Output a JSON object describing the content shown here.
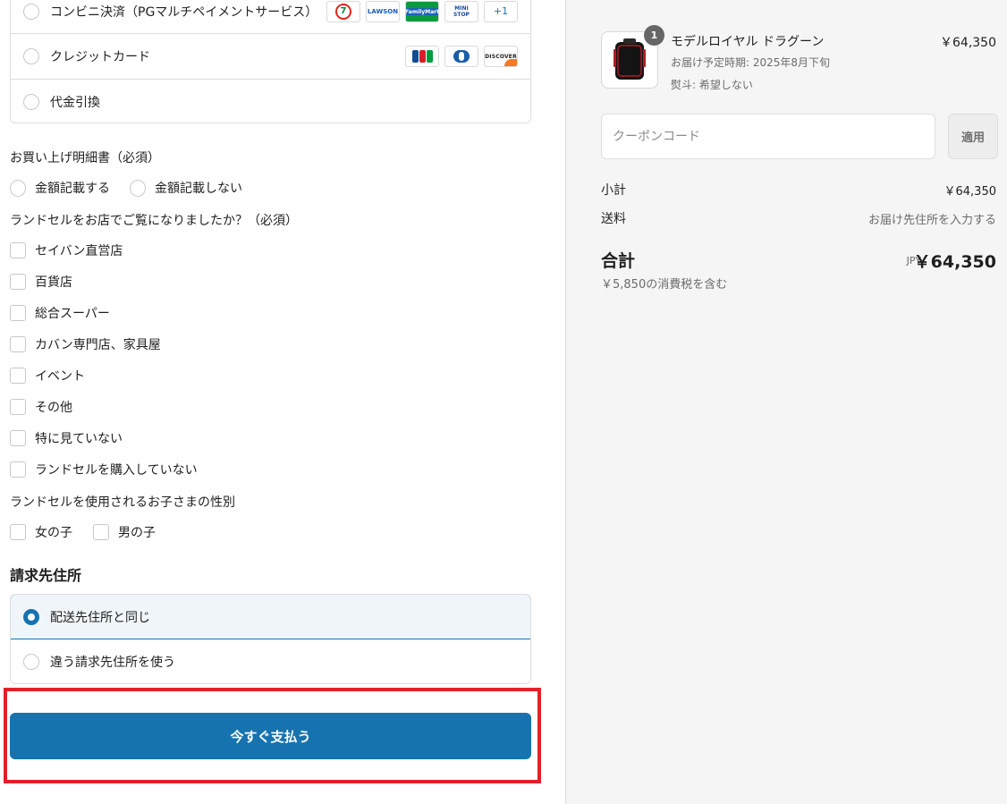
{
  "payment_methods": {
    "items": [
      {
        "label": "コンビニ決済（PGマルチペイメントサービス）"
      },
      {
        "label": "クレジットカード"
      },
      {
        "label": "代金引換"
      }
    ],
    "konbini_logos": [
      "seven-eleven",
      "LAWSON",
      "FamilyMart",
      "MINI STOP",
      "+1"
    ],
    "card_logos": [
      "JCB",
      "Diners Club",
      "DISCOVER"
    ]
  },
  "logo_text": {
    "lawson": "LAWSON",
    "familymart": "FamilyMart",
    "ministop_1": "MINI",
    "ministop_2": "STOP",
    "plus": "+1",
    "discover": "DISCOVER"
  },
  "form": {
    "receipt": {
      "label": "お買い上げ明細書（必須）",
      "options": [
        "金額記載する",
        "金額記載しない"
      ]
    },
    "store_seen": {
      "label": "ランドセルをお店でご覧になりましたか？（必須）",
      "options": [
        "セイバン直営店",
        "百貨店",
        "総合スーパー",
        "カバン専門店、家具屋",
        "イベント",
        "その他",
        "特に見ていない",
        "ランドセルを購入していない"
      ]
    },
    "child_gender": {
      "label": "ランドセルを使用されるお子さまの性別",
      "options": [
        "女の子",
        "男の子"
      ]
    }
  },
  "billing": {
    "title": "請求先住所",
    "options": [
      "配送先住所と同じ",
      "違う請求先住所を使う"
    ],
    "selected_index": 0
  },
  "pay_button": {
    "label": "今すぐ支払う"
  },
  "summary": {
    "item": {
      "quantity": "1",
      "name": "モデルロイヤル ドラグーン",
      "price": "￥64,350",
      "delivery": "お届け予定時期: 2025年8月下旬",
      "noshi": "熨斗: 希望しない"
    },
    "coupon": {
      "placeholder": "クーポンコード",
      "apply_label": "適用"
    },
    "subtotal": {
      "label": "小計",
      "value": "￥64,350"
    },
    "shipping": {
      "label": "送料",
      "value": "お届け先住所を入力する"
    },
    "total": {
      "label": "合計",
      "currency": "JPY",
      "value": "￥64,350",
      "tax_note": "￥5,850の消費税を含む"
    }
  },
  "colors": {
    "accent": "#1773b0",
    "highlight_frame": "#e2202a",
    "summary_bg": "#f5f5f5"
  }
}
